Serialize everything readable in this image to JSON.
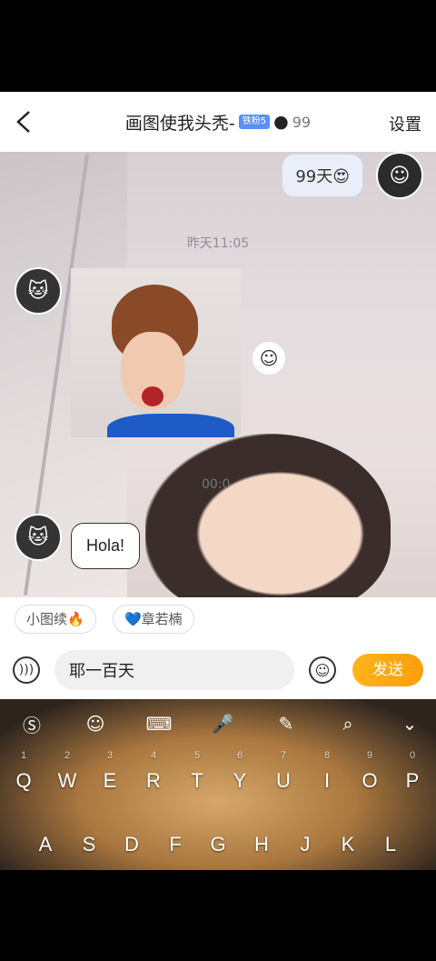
{
  "header": {
    "back_icon": "chevron-left-icon",
    "title": "画图使我头秃-",
    "vip_badge": "铁粉5",
    "count": "99",
    "settings": "设置"
  },
  "chat": {
    "right_message": "99天😍",
    "timestamp1": "昨天11:05",
    "timestamp2": "00:0",
    "left_message": "Hola!",
    "react_icon": "smile-icon"
  },
  "quick_replies": [
    "小图续🔥",
    "💙章若楠"
  ],
  "input": {
    "value": "耶一百天",
    "send_label": "发送"
  },
  "keyboard": {
    "toolbar": [
      "sogou-icon",
      "emoji-icon",
      "keyboard-icon",
      "mic-icon",
      "handwrite-icon",
      "search-icon",
      "collapse-icon"
    ],
    "row1": [
      "Q",
      "W",
      "E",
      "R",
      "T",
      "Y",
      "U",
      "I",
      "O",
      "P"
    ],
    "row1_nums": [
      "1",
      "2",
      "3",
      "4",
      "5",
      "6",
      "7",
      "8",
      "9",
      "0"
    ],
    "row2": [
      "A",
      "S",
      "D",
      "F",
      "G",
      "H",
      "J",
      "K",
      "L"
    ]
  },
  "colors": {
    "accent": "#ffa60f",
    "badge": "#5b8ff0"
  }
}
